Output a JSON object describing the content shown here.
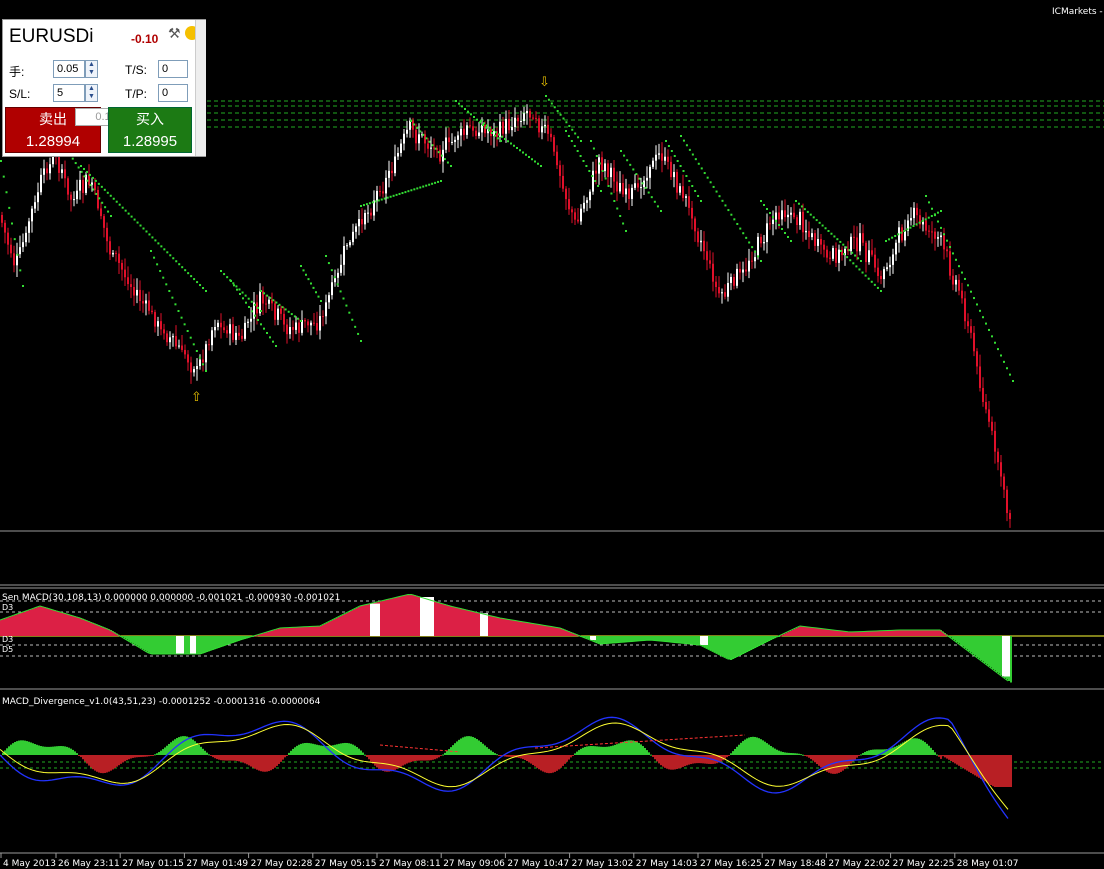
{
  "broker": "ICMarkets -",
  "trade_panel": {
    "symbol": "EURUSDi",
    "change": "-0.10",
    "lots_label": "手:",
    "lots_value": "0.05",
    "ts_label": "T/S:",
    "ts_value": "0",
    "sl_label": "S/L:",
    "sl_value": "5",
    "tp_label": "T/P:",
    "tp_value": "0",
    "sell_label": "卖出",
    "buy_label": "买入",
    "lot_step": "0.1",
    "sell_price": "1.28994",
    "buy_price": "1.28995",
    "tools_icon": "tools-icon",
    "settings_icon": "settings-icon"
  },
  "indicators": {
    "macd_label": "Sen MACD(30,108,13) 0.000000 0.000000 -0.001021 -0.000930 -0.001021",
    "macd_level_top": "D3",
    "macd_level_mid": "D3",
    "macd_level_low": "D5",
    "divergence_label": "MACD_Divergence_v1.0(43,51,23) -0.0001252 -0.0001316 -0.0000064"
  },
  "time_axis": [
    "4 May 2013",
    "26 May 23:11",
    "27 May 01:15",
    "27 May 01:49",
    "27 May 02:28",
    "27 May 05:15",
    "27 May 08:11",
    "27 May 09:06",
    "27 May 10:47",
    "27 May 13:02",
    "27 May 14:03",
    "27 May 16:25",
    "27 May 18:48",
    "27 May 22:02",
    "27 May 22:25",
    "28 May 01:07"
  ],
  "colors": {
    "background": "#000000",
    "bull_candle": "#ffffff",
    "bear_candle": "#e0102a",
    "trail": "#33dd33",
    "level_lines": "#22aa22",
    "histo_pos": "#dc2045",
    "histo_neg": "#33cc33",
    "signal_yellow": "#ffff33",
    "main_blue": "#2233ff"
  }
}
